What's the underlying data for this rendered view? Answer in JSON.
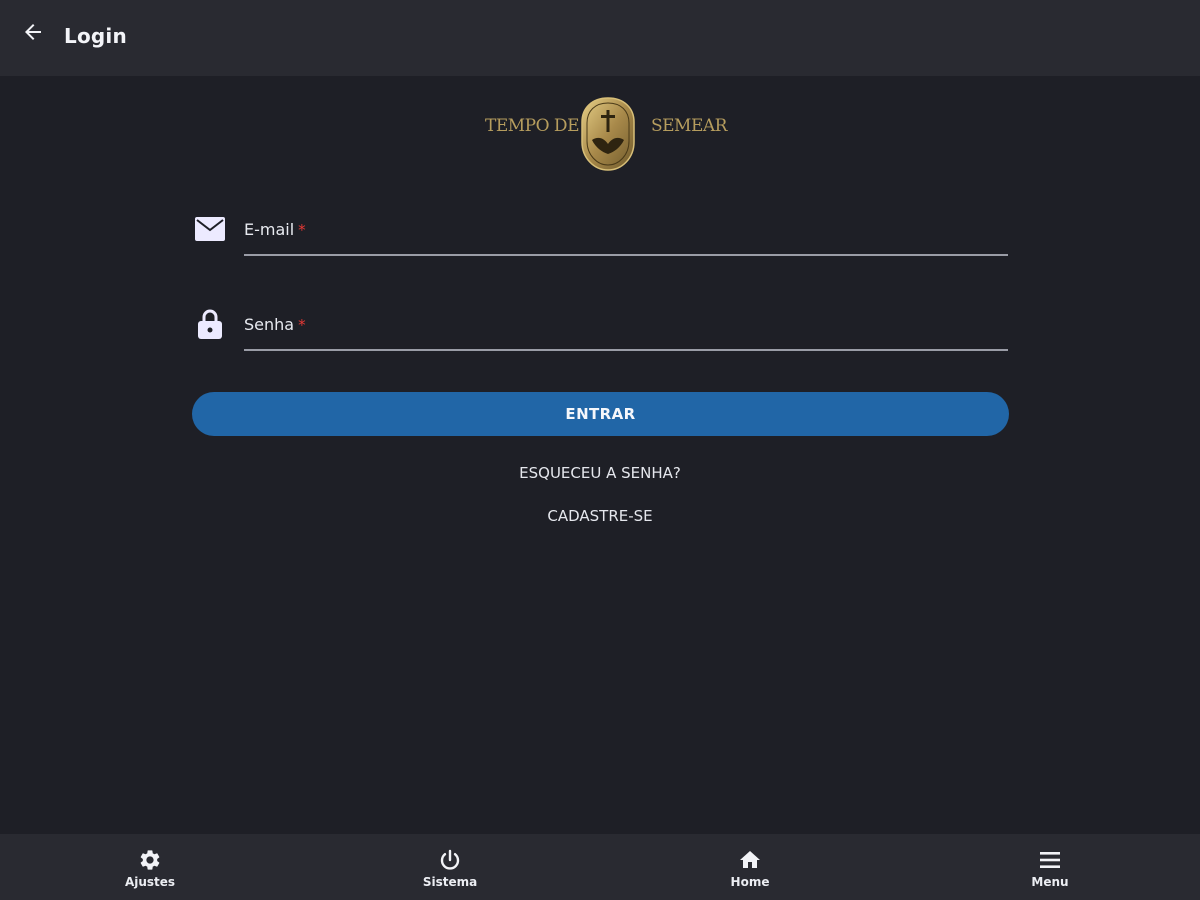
{
  "header": {
    "title": "Login",
    "back_icon": "arrow-left-icon"
  },
  "logo": {
    "left_text": "TEMPO DE",
    "right_text": "SEMEAR",
    "accent_color": "#b69d5e"
  },
  "form": {
    "email": {
      "label": "E-mail",
      "required_mark": "*",
      "icon": "mail-icon",
      "value": ""
    },
    "password": {
      "label": "Senha",
      "required_mark": "*",
      "icon": "lock-icon",
      "value": ""
    },
    "submit_label": "ENTRAR",
    "forgot_label": "ESQUECEU A SENHA?",
    "signup_label": "CADASTRE-SE"
  },
  "bottom_nav": {
    "items": [
      {
        "label": "Ajustes",
        "icon": "gear-icon"
      },
      {
        "label": "Sistema",
        "icon": "power-icon"
      },
      {
        "label": "Home",
        "icon": "home-icon"
      },
      {
        "label": "Menu",
        "icon": "hamburger-menu-icon"
      }
    ]
  },
  "colors": {
    "background": "#1e1f26",
    "bar": "#292a31",
    "primary_button": "#2166a7",
    "required": "#e53935"
  }
}
